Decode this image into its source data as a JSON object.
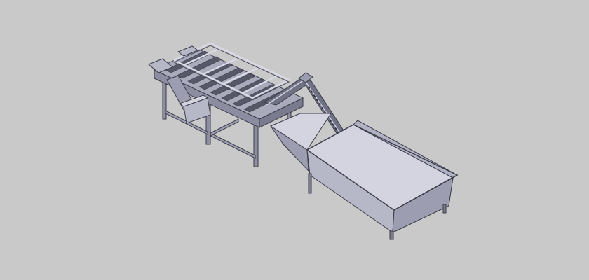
{
  "scene": {
    "subject": "cad-isometric-conveyor-machine",
    "colors": {
      "background": "#c9c9c9",
      "steel_light": "#b7b8c7",
      "steel_mid": "#9c9db0",
      "steel_dark": "#6f7184",
      "steel_shadow": "#5e6072",
      "belt_dark": "#565868",
      "edge": "#3b3c48",
      "tank_inner": "#d3d4e0",
      "tank_side": "#b0b1c3"
    }
  }
}
